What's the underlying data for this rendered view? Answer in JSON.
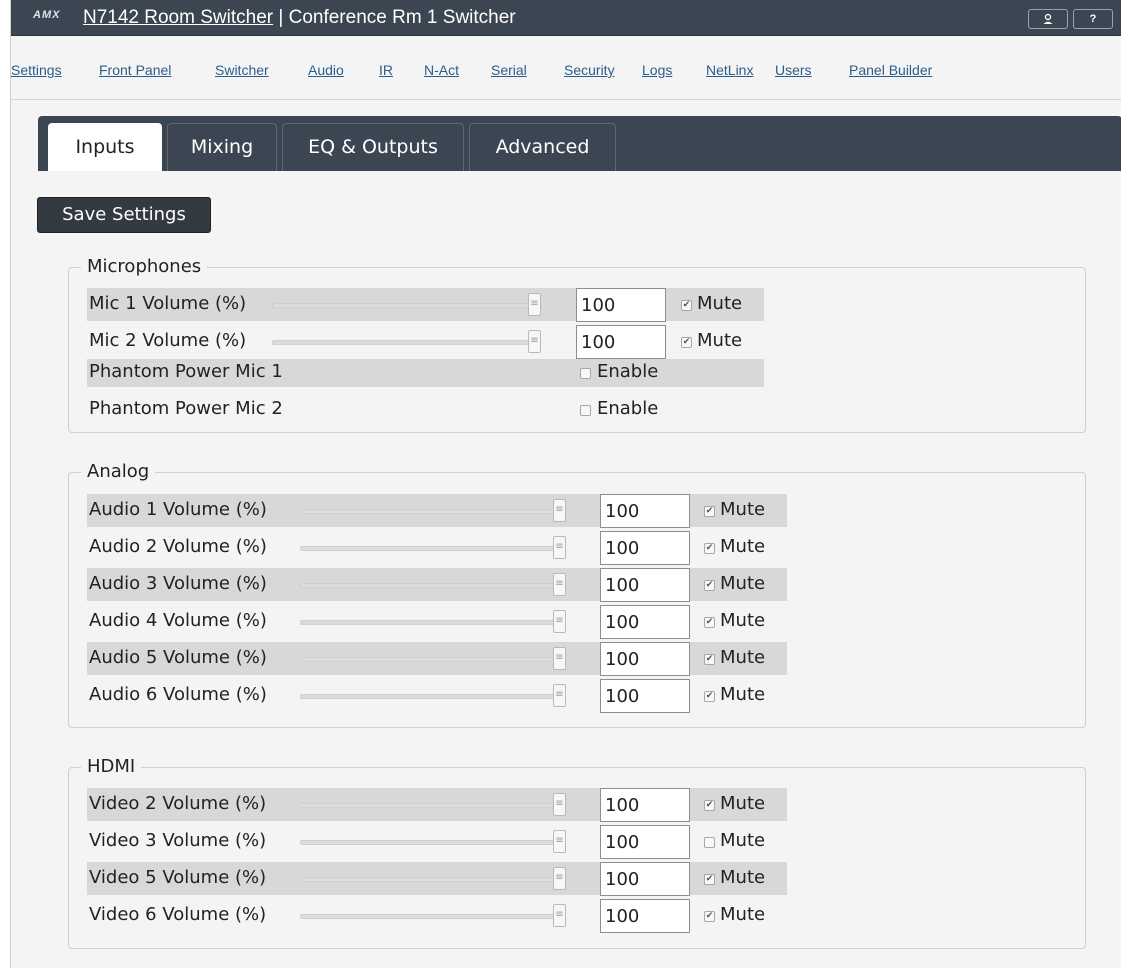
{
  "header": {
    "logo": "AMX",
    "device_link": "N7142 Room Switcher",
    "separator": " | ",
    "room_title": "Conference Rm 1 Switcher",
    "user_icon": "user-icon",
    "help_label": "?"
  },
  "nav": {
    "items": [
      "Settings",
      "Front Panel",
      "Switcher",
      "Audio",
      "IR",
      "N-Act",
      "Serial",
      "Security",
      "Logs",
      "NetLinx",
      "Users",
      "Panel Builder"
    ]
  },
  "tabs": [
    {
      "label": "Inputs",
      "active": true
    },
    {
      "label": "Mixing",
      "active": false
    },
    {
      "label": "EQ & Outputs",
      "active": false
    },
    {
      "label": "Advanced",
      "active": false
    }
  ],
  "save_label": "Save Settings",
  "mute_label": "Mute",
  "enable_label": "Enable",
  "groups": {
    "microphones": {
      "legend": "Microphones",
      "volumes": [
        {
          "label": "Mic 1 Volume (%)",
          "value": "100",
          "level": 100,
          "mute": true
        },
        {
          "label": "Mic 2 Volume (%)",
          "value": "100",
          "level": 100,
          "mute": true
        }
      ],
      "phantom": [
        {
          "label": "Phantom Power Mic 1",
          "enabled": false
        },
        {
          "label": "Phantom Power Mic 2",
          "enabled": false
        }
      ]
    },
    "analog": {
      "legend": "Analog",
      "volumes": [
        {
          "label": "Audio 1 Volume (%)",
          "value": "100",
          "level": 100,
          "mute": true
        },
        {
          "label": "Audio 2 Volume (%)",
          "value": "100",
          "level": 100,
          "mute": true
        },
        {
          "label": "Audio 3 Volume (%)",
          "value": "100",
          "level": 100,
          "mute": true
        },
        {
          "label": "Audio 4 Volume (%)",
          "value": "100",
          "level": 100,
          "mute": true
        },
        {
          "label": "Audio 5 Volume (%)",
          "value": "100",
          "level": 100,
          "mute": true
        },
        {
          "label": "Audio 6 Volume (%)",
          "value": "100",
          "level": 100,
          "mute": true
        }
      ]
    },
    "hdmi": {
      "legend": "HDMI",
      "volumes": [
        {
          "label": "Video 2 Volume (%)",
          "value": "100",
          "level": 100,
          "mute": true
        },
        {
          "label": "Video 3 Volume (%)",
          "value": "100",
          "level": 100,
          "mute": false
        },
        {
          "label": "Video 5 Volume (%)",
          "value": "100",
          "level": 100,
          "mute": true
        },
        {
          "label": "Video 6 Volume (%)",
          "value": "100",
          "level": 100,
          "mute": true
        }
      ]
    }
  }
}
